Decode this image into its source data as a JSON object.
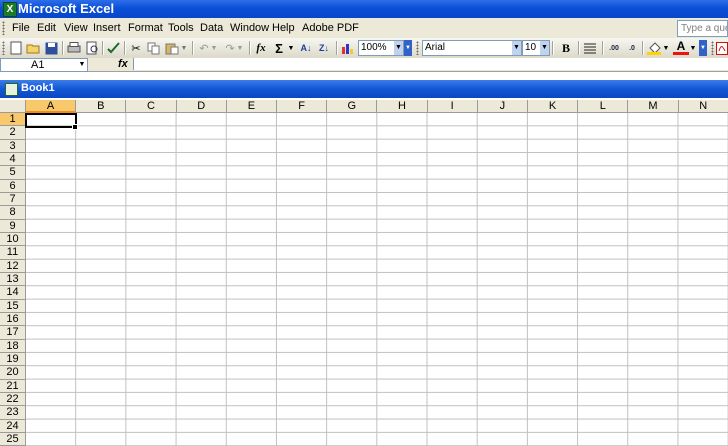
{
  "window": {
    "title": "Microsoft Excel",
    "app_icon": "excel-icon"
  },
  "menu": {
    "items": [
      {
        "label": "File"
      },
      {
        "label": "Edit"
      },
      {
        "label": "View"
      },
      {
        "label": "Insert"
      },
      {
        "label": "Format"
      },
      {
        "label": "Tools"
      },
      {
        "label": "Data"
      },
      {
        "label": "Window"
      },
      {
        "label": "Help"
      },
      {
        "label": "Adobe PDF"
      }
    ],
    "help_placeholder": "Type a question for help"
  },
  "toolbar": {
    "zoom": "100%",
    "font_name": "Arial",
    "font_size": "10",
    "fx": "fx",
    "sigma": "Σ"
  },
  "formula_bar": {
    "name_box": "A1",
    "content": ""
  },
  "workbook": {
    "title": "Book1"
  },
  "grid": {
    "columns": [
      "A",
      "B",
      "C",
      "D",
      "E",
      "F",
      "G",
      "H",
      "I",
      "J",
      "K",
      "L",
      "M",
      "N"
    ],
    "rows": [
      "1",
      "2",
      "3",
      "4",
      "5",
      "6",
      "7",
      "8",
      "9",
      "10",
      "11",
      "12",
      "13",
      "14",
      "15",
      "16",
      "17",
      "18",
      "19",
      "20",
      "21",
      "22",
      "23",
      "24",
      "25"
    ],
    "active_cell": "A1"
  },
  "colors": {
    "title_blue": "#0a4fd8",
    "chrome": "#ece9d8",
    "selected_header": "#f8c86a",
    "gridline": "#c0c0c0"
  }
}
